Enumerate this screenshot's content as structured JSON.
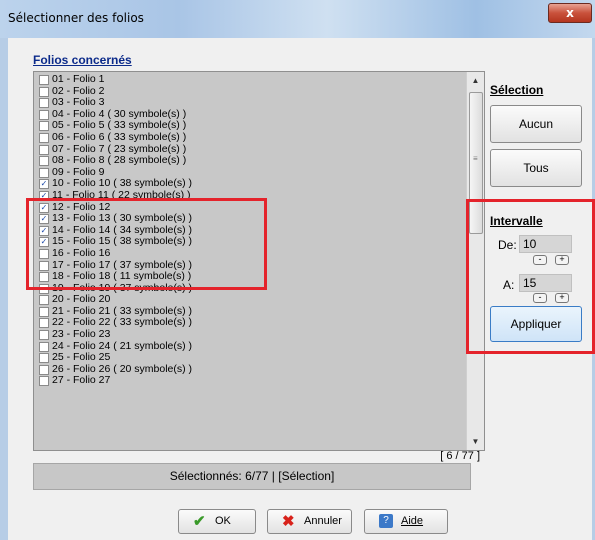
{
  "window": {
    "title": "Sélectionner des folios",
    "close_glyph": "x"
  },
  "folios_section": {
    "label": "Folios concernés",
    "items": [
      {
        "label": "01 - Folio 1",
        "checked": false
      },
      {
        "label": "02 - Folio 2",
        "checked": false
      },
      {
        "label": "03 - Folio 3",
        "checked": false
      },
      {
        "label": "04 - Folio 4 ( 30 symbole(s) )",
        "checked": false
      },
      {
        "label": "05 - Folio 5 ( 33 symbole(s) )",
        "checked": false
      },
      {
        "label": "06 - Folio 6 ( 33 symbole(s) )",
        "checked": false
      },
      {
        "label": "07 - Folio 7 ( 23 symbole(s) )",
        "checked": false
      },
      {
        "label": "08 - Folio 8 ( 28 symbole(s) )",
        "checked": false
      },
      {
        "label": "09 - Folio 9",
        "checked": false
      },
      {
        "label": "10 - Folio 10 ( 38 symbole(s) )",
        "checked": true
      },
      {
        "label": "11 - Folio 11 ( 22 symbole(s) )",
        "checked": true
      },
      {
        "label": "12 - Folio 12",
        "checked": true
      },
      {
        "label": "13 - Folio 13 ( 30 symbole(s) )",
        "checked": true
      },
      {
        "label": "14 - Folio 14 ( 34 symbole(s) )",
        "checked": true
      },
      {
        "label": "15 - Folio 15 ( 38 symbole(s) )",
        "checked": true
      },
      {
        "label": "16 - Folio 16",
        "checked": false
      },
      {
        "label": "17 - Folio 17 ( 37 symbole(s) )",
        "checked": false
      },
      {
        "label": "18 - Folio 18 ( 11 symbole(s) )",
        "checked": false
      },
      {
        "label": "19 - Folio 19 ( 37 symbole(s) )",
        "checked": false
      },
      {
        "label": "20 - Folio 20",
        "checked": false
      },
      {
        "label": "21 - Folio 21 ( 33 symbole(s) )",
        "checked": false
      },
      {
        "label": "22 - Folio 22 ( 33 symbole(s) )",
        "checked": false
      },
      {
        "label": "23 - Folio 23",
        "checked": false
      },
      {
        "label": "24 - Folio 24 ( 21 symbole(s) )",
        "checked": false
      },
      {
        "label": "25 - Folio 25",
        "checked": false
      },
      {
        "label": "26 - Folio 26 ( 20 symbole(s) )",
        "checked": false
      },
      {
        "label": "27 - Folio 27",
        "checked": false
      }
    ],
    "counter": "[ 6 / 77 ]",
    "status": "Sélectionnés: 6/77  |  [Sélection]"
  },
  "selection_panel": {
    "label": "Sélection",
    "none_button": "Aucun",
    "all_button": "Tous"
  },
  "interval_panel": {
    "label": "Intervalle",
    "from_label": "De:",
    "from_value": "10",
    "to_label": "A:",
    "to_value": "15",
    "minus": "-",
    "plus": "+",
    "apply_button": "Appliquer"
  },
  "dialog_buttons": {
    "ok": "OK",
    "cancel": "Annuler",
    "help": "Aide"
  },
  "colors": {
    "annotation_red": "#e4232b",
    "check_blue": "#1a48a8"
  }
}
